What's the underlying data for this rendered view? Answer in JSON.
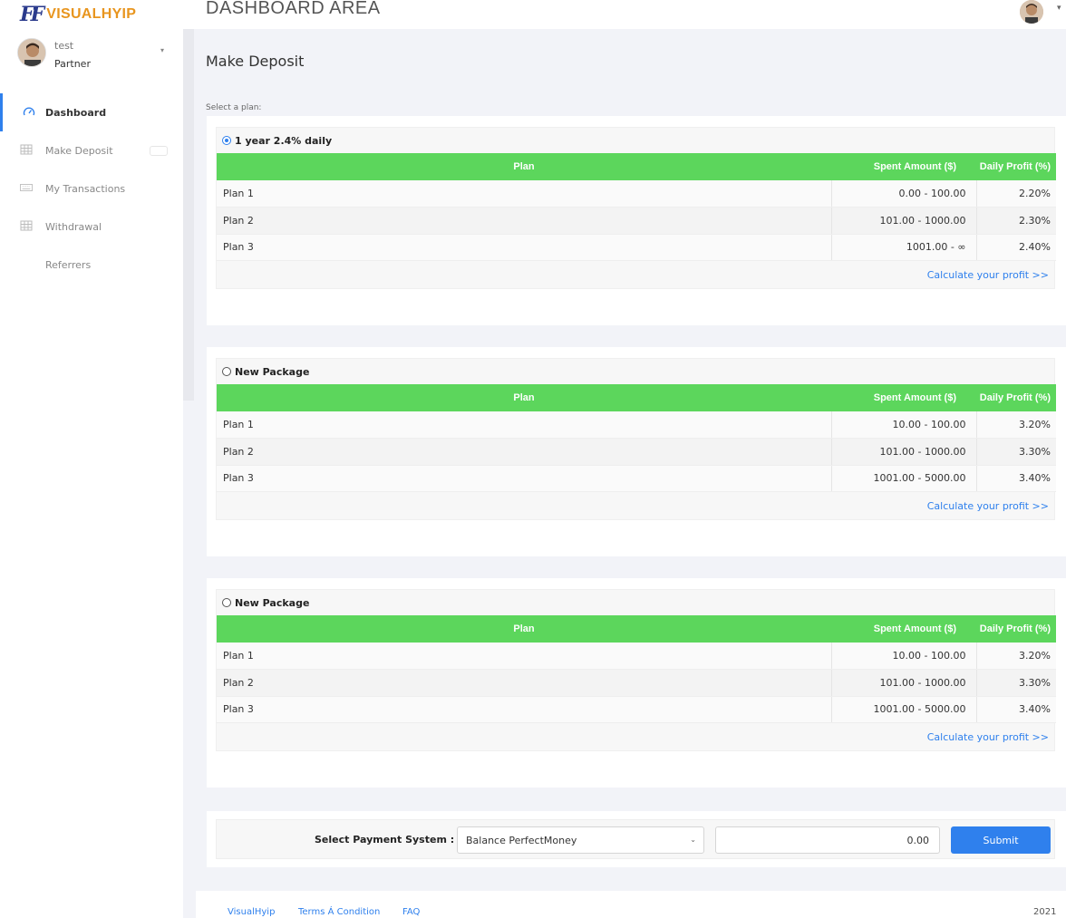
{
  "brand": {
    "mark": "FF",
    "name": "VISUALHYIP"
  },
  "header": {
    "title": "DASHBOARD AREA"
  },
  "user": {
    "name": "test",
    "role": "Partner"
  },
  "sidebar": {
    "items": [
      {
        "label": "Dashboard",
        "icon": "dashboard-gauge-icon",
        "active": true
      },
      {
        "label": "Make Deposit",
        "icon": "grid-icon",
        "active": false
      },
      {
        "label": "My Transactions",
        "icon": "keyboard-icon",
        "active": false
      },
      {
        "label": "Withdrawal",
        "icon": "grid-icon",
        "active": false
      },
      {
        "label": "Referrers",
        "icon": "",
        "active": false
      }
    ]
  },
  "main": {
    "title": "Make Deposit",
    "select_plan_label": "Select a plan:",
    "columns": {
      "plan": "Plan",
      "amount": "Spent Amount ($)",
      "profit": "Daily Profit (%)"
    },
    "calc_link": "Calculate your profit >>",
    "plans": [
      {
        "name": "1 year 2.4% daily",
        "selected": true,
        "rows": [
          {
            "plan": "Plan 1",
            "amount": "0.00 - 100.00",
            "profit": "2.20%"
          },
          {
            "plan": "Plan 2",
            "amount": "101.00 - 1000.00",
            "profit": "2.30%"
          },
          {
            "plan": "Plan 3",
            "amount": "1001.00 - ∞",
            "profit": "2.40%"
          }
        ]
      },
      {
        "name": "New Package",
        "selected": false,
        "rows": [
          {
            "plan": "Plan 1",
            "amount": "10.00 - 100.00",
            "profit": "3.20%"
          },
          {
            "plan": "Plan 2",
            "amount": "101.00 - 1000.00",
            "profit": "3.30%"
          },
          {
            "plan": "Plan 3",
            "amount": "1001.00 - 5000.00",
            "profit": "3.40%"
          }
        ]
      },
      {
        "name": "New Package",
        "selected": false,
        "rows": [
          {
            "plan": "Plan 1",
            "amount": "10.00 - 100.00",
            "profit": "3.20%"
          },
          {
            "plan": "Plan 2",
            "amount": "101.00 - 1000.00",
            "profit": "3.30%"
          },
          {
            "plan": "Plan 3",
            "amount": "1001.00 - 5000.00",
            "profit": "3.40%"
          }
        ]
      }
    ]
  },
  "payment": {
    "label": "Select Payment System :",
    "selected": "Balance PerfectMoney",
    "amount": "0.00",
    "submit": "Submit"
  },
  "footer": {
    "links": [
      "VisualHyip",
      "Terms Á Condition",
      "FAQ"
    ],
    "year": "2021"
  },
  "colors": {
    "accent": "#2f80ed",
    "table_header": "#5cd65c",
    "brand_orange": "#e8951e",
    "brand_blue": "#2a3a8c"
  }
}
